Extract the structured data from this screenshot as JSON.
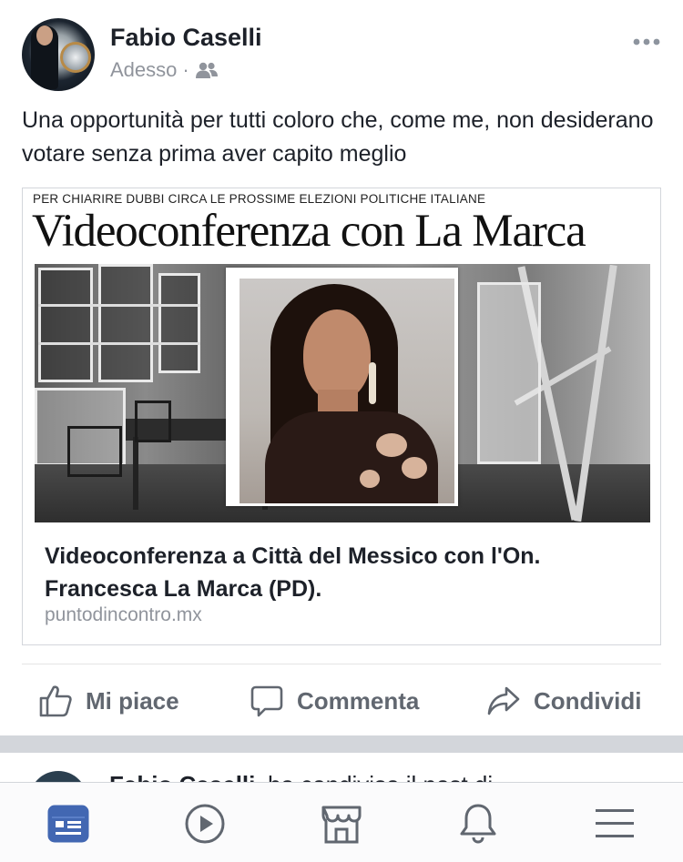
{
  "post": {
    "author": "Fabio Caselli",
    "timestamp": "Adesso",
    "separator": "·",
    "audience_icon": "friends-icon",
    "text": "Una opportunità per tutti coloro che, come me, non desiderano votare senza prima aver capito meglio",
    "link": {
      "image_kicker": "PER CHIARIRE DUBBI CIRCA LE PROSSIME ELEZIONI POLITICHE ITALIANE",
      "image_headline": "Videoconferenza con La Marca",
      "title": "Videoconferenza a Città del Messico con l'On. Francesca La Marca (PD).",
      "domain": "puntodincontro.mx"
    },
    "actions": {
      "like": "Mi piace",
      "comment": "Commenta",
      "share": "Condividi"
    }
  },
  "next_post": {
    "author": "Fabio Caselli",
    "snippet": "ha condiviso il post di"
  },
  "tabbar": {
    "items": [
      "news-feed-icon",
      "video-icon",
      "marketplace-icon",
      "notifications-icon",
      "menu-icon"
    ],
    "active": "news-feed-icon",
    "active_color": "#4267b2",
    "inactive_color": "#616770"
  }
}
